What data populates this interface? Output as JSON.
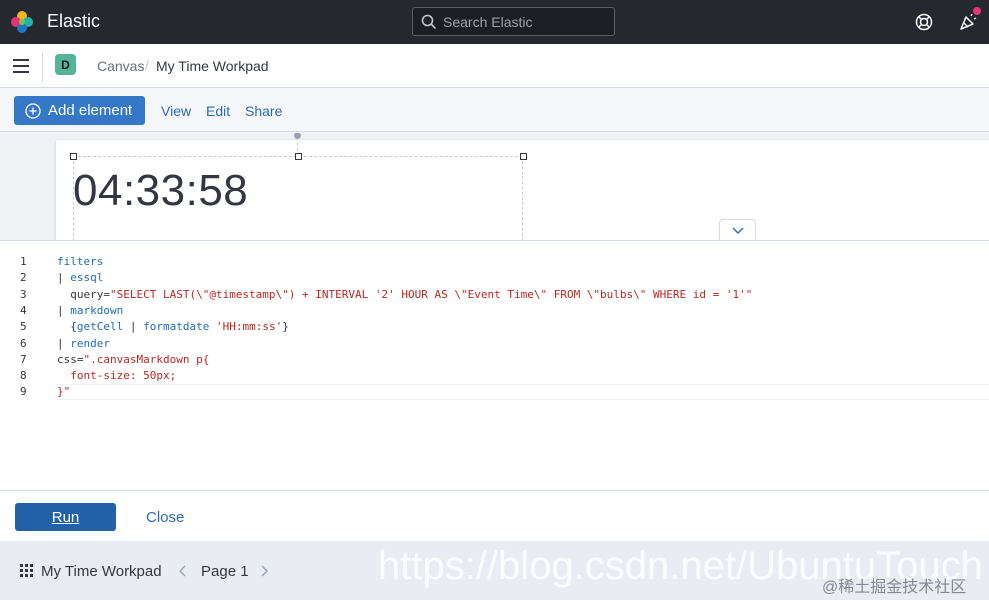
{
  "header": {
    "brand": "Elastic",
    "search_placeholder": "Search Elastic"
  },
  "breadcrumb": {
    "space_initial": "D",
    "parent": "Canvas",
    "separator": "/",
    "current": "My Time Workpad"
  },
  "toolbar": {
    "add_element": "Add element",
    "view": "View",
    "edit": "Edit",
    "share": "Share"
  },
  "canvas": {
    "clock_text": "04:33:58"
  },
  "editor": {
    "lines": [
      {
        "n": "1",
        "parts": [
          {
            "t": "fn",
            "s": "filters"
          }
        ]
      },
      {
        "n": "2",
        "parts": [
          {
            "t": "txt",
            "s": "| "
          },
          {
            "t": "fn",
            "s": "essql"
          }
        ]
      },
      {
        "n": "3",
        "parts": [
          {
            "t": "txt",
            "s": "  query="
          },
          {
            "t": "str",
            "s": "\"SELECT LAST(\\\"@timestamp\\\") + INTERVAL '2' HOUR AS \\\"Event Time\\\" FROM \\\"bulbs\\\" WHERE id = '1'\""
          }
        ]
      },
      {
        "n": "4",
        "parts": [
          {
            "t": "txt",
            "s": "| "
          },
          {
            "t": "fn",
            "s": "markdown"
          }
        ]
      },
      {
        "n": "5",
        "parts": [
          {
            "t": "txt",
            "s": "  {"
          },
          {
            "t": "fn",
            "s": "getCell"
          },
          {
            "t": "txt",
            "s": " | "
          },
          {
            "t": "fn",
            "s": "formatdate"
          },
          {
            "t": "txt",
            "s": " "
          },
          {
            "t": "str",
            "s": "'HH:mm:ss'"
          },
          {
            "t": "txt",
            "s": "}"
          }
        ]
      },
      {
        "n": "6",
        "parts": [
          {
            "t": "txt",
            "s": "| "
          },
          {
            "t": "fn",
            "s": "render"
          }
        ]
      },
      {
        "n": "7",
        "parts": [
          {
            "t": "txt",
            "s": "css="
          },
          {
            "t": "str",
            "s": "\".canvasMarkdown p{"
          }
        ]
      },
      {
        "n": "8",
        "parts": [
          {
            "t": "str",
            "s": "  font-size: 50px;"
          }
        ]
      },
      {
        "n": "9",
        "parts": [
          {
            "t": "str",
            "s": "}\""
          }
        ]
      }
    ]
  },
  "actions": {
    "run": "Run",
    "close": "Close"
  },
  "footer": {
    "workpad_name": "My Time Workpad",
    "page_label": "Page 1"
  },
  "watermark": {
    "url": "https://blog.csdn.net/UbuntuTouch",
    "cn": "@稀土掘金技术社区"
  }
}
